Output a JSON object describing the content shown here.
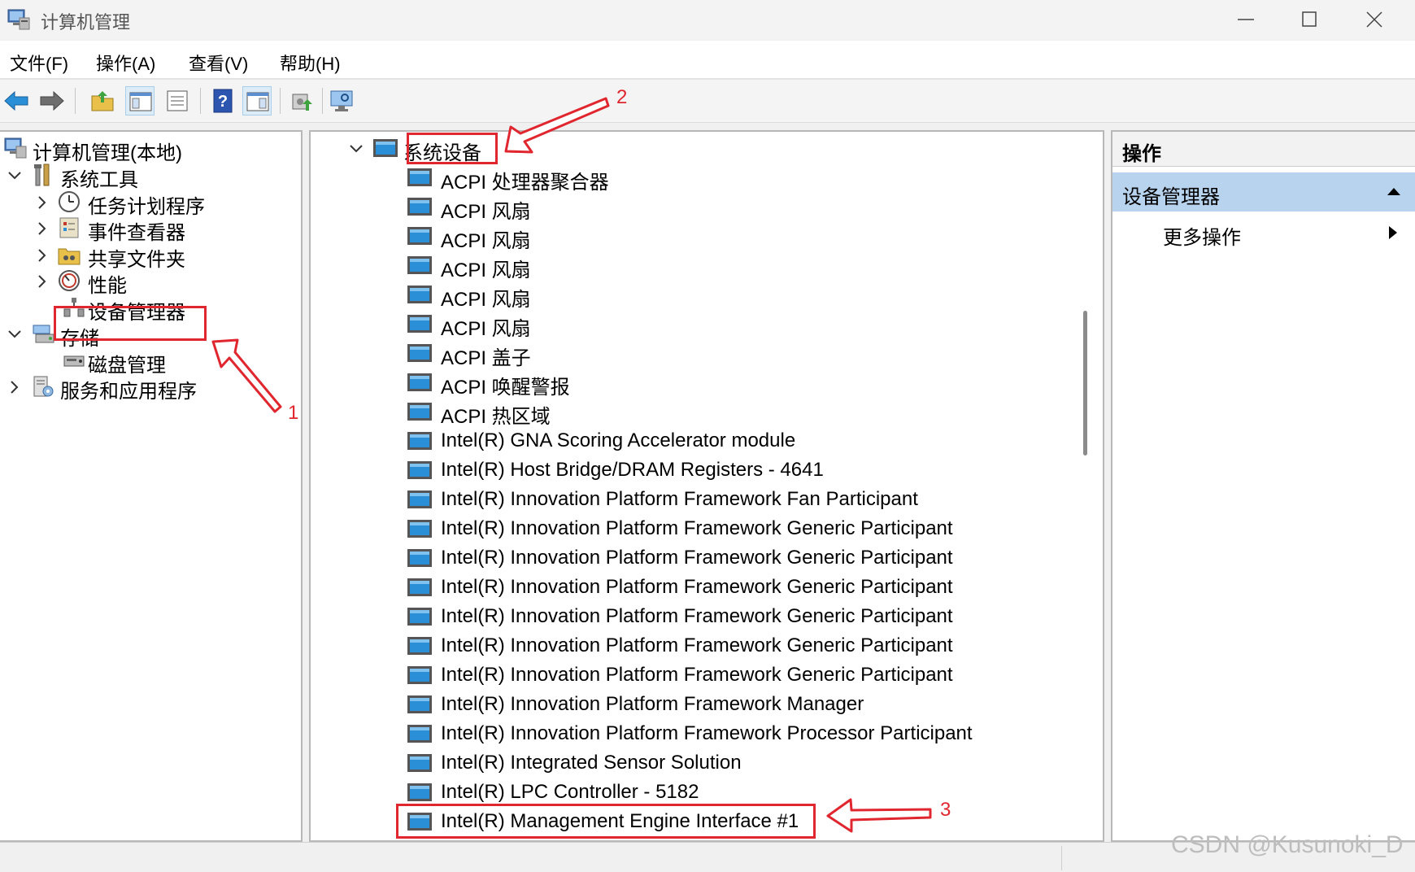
{
  "window": {
    "title": "计算机管理"
  },
  "menu": [
    "文件(F)",
    "操作(A)",
    "查看(V)",
    "帮助(H)"
  ],
  "left_tree": {
    "root": "计算机管理(本地)",
    "system_tools": "系统工具",
    "task_scheduler": "任务计划程序",
    "event_viewer": "事件查看器",
    "shared_folders": "共享文件夹",
    "performance": "性能",
    "device_manager": "设备管理器",
    "storage": "存储",
    "disk_management": "磁盘管理",
    "services_apps": "服务和应用程序"
  },
  "device_tree": {
    "category": "系统设备",
    "devices": [
      "ACPI 处理器聚合器",
      "ACPI 风扇",
      "ACPI 风扇",
      "ACPI 风扇",
      "ACPI 风扇",
      "ACPI 风扇",
      "ACPI 盖子",
      "ACPI 唤醒警报",
      "ACPI 热区域",
      "Intel(R) GNA Scoring Accelerator module",
      "Intel(R) Host Bridge/DRAM Registers - 4641",
      "Intel(R) Innovation Platform Framework Fan Participant",
      "Intel(R) Innovation Platform Framework Generic Participant",
      "Intel(R) Innovation Platform Framework Generic Participant",
      "Intel(R) Innovation Platform Framework Generic Participant",
      "Intel(R) Innovation Platform Framework Generic Participant",
      "Intel(R) Innovation Platform Framework Generic Participant",
      "Intel(R) Innovation Platform Framework Generic Participant",
      "Intel(R) Innovation Platform Framework Manager",
      "Intel(R) Innovation Platform Framework Processor Participant",
      "Intel(R) Integrated Sensor Solution",
      "Intel(R) LPC Controller - 5182",
      "Intel(R) Management Engine Interface #1"
    ]
  },
  "actions": {
    "header": "操作",
    "section": "设备管理器",
    "more": "更多操作"
  },
  "annotations": [
    "1",
    "2",
    "3"
  ],
  "watermark": "CSDN @Kusunoki_D",
  "colors": {
    "annotation": "#e0262e",
    "selection": "#b8d3ee",
    "folder": "#2a8fd6"
  }
}
